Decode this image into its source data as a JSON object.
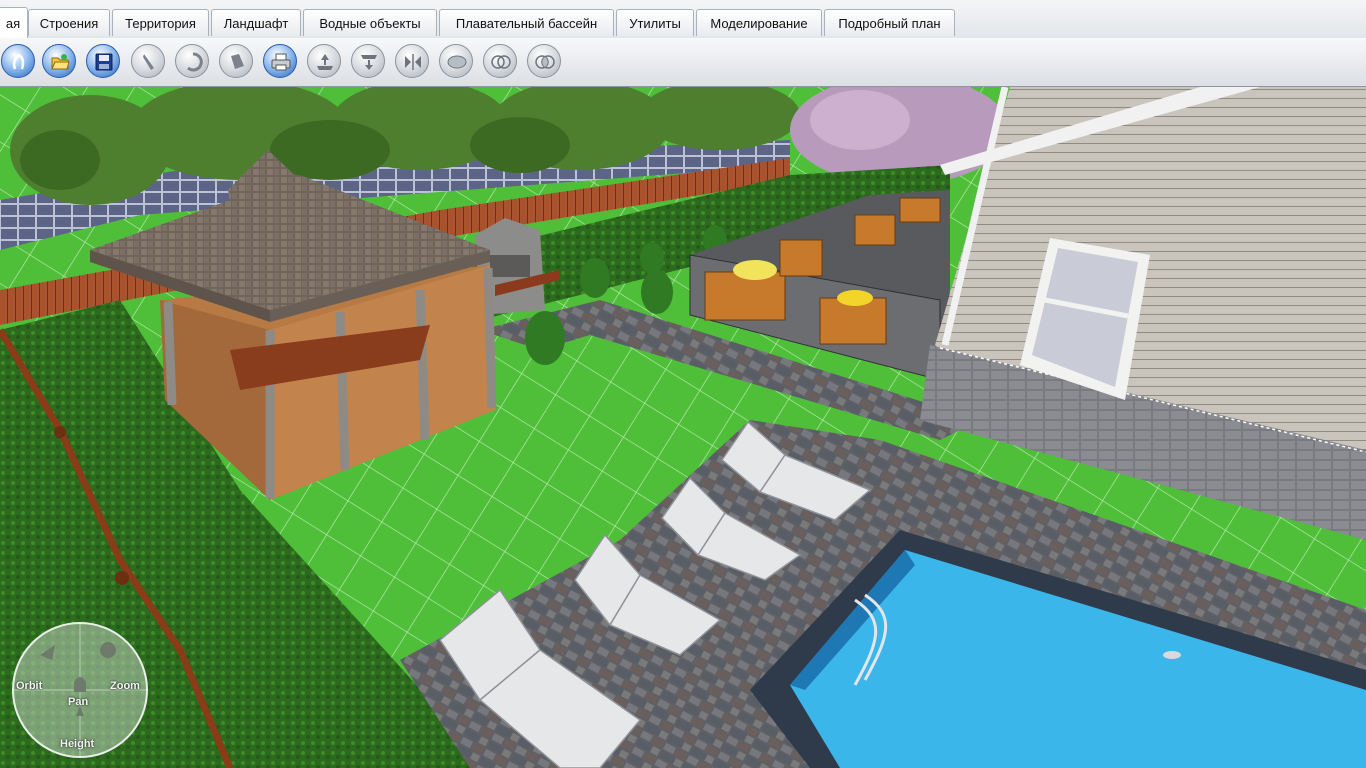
{
  "tabs": [
    {
      "label": "ая",
      "active": true
    },
    {
      "label": "Строения"
    },
    {
      "label": "Территория"
    },
    {
      "label": "Ландшафт"
    },
    {
      "label": "Водные объекты"
    },
    {
      "label": "Плавательный бассейн"
    },
    {
      "label": "Утилиты"
    },
    {
      "label": "Моделирование"
    },
    {
      "label": "Подробный план"
    }
  ],
  "toolbar": {
    "icons": [
      "select-icon",
      "open-folder-icon",
      "save-icon",
      "pencil-icon",
      "rotate-icon",
      "paint-icon",
      "print-icon",
      "raise-icon",
      "lower-icon",
      "mirror-icon",
      "join-icon",
      "subtract-icon",
      "intersect-icon"
    ]
  },
  "navigator": {
    "orbit": "Orbit",
    "pan": "Pan",
    "zoom": "Zoom",
    "height": "Height"
  },
  "colors": {
    "accent": "#2b62b8",
    "lawn": "#4fbf3a",
    "pool": "#2aa9e0",
    "hedge": "#2e6e1e"
  }
}
